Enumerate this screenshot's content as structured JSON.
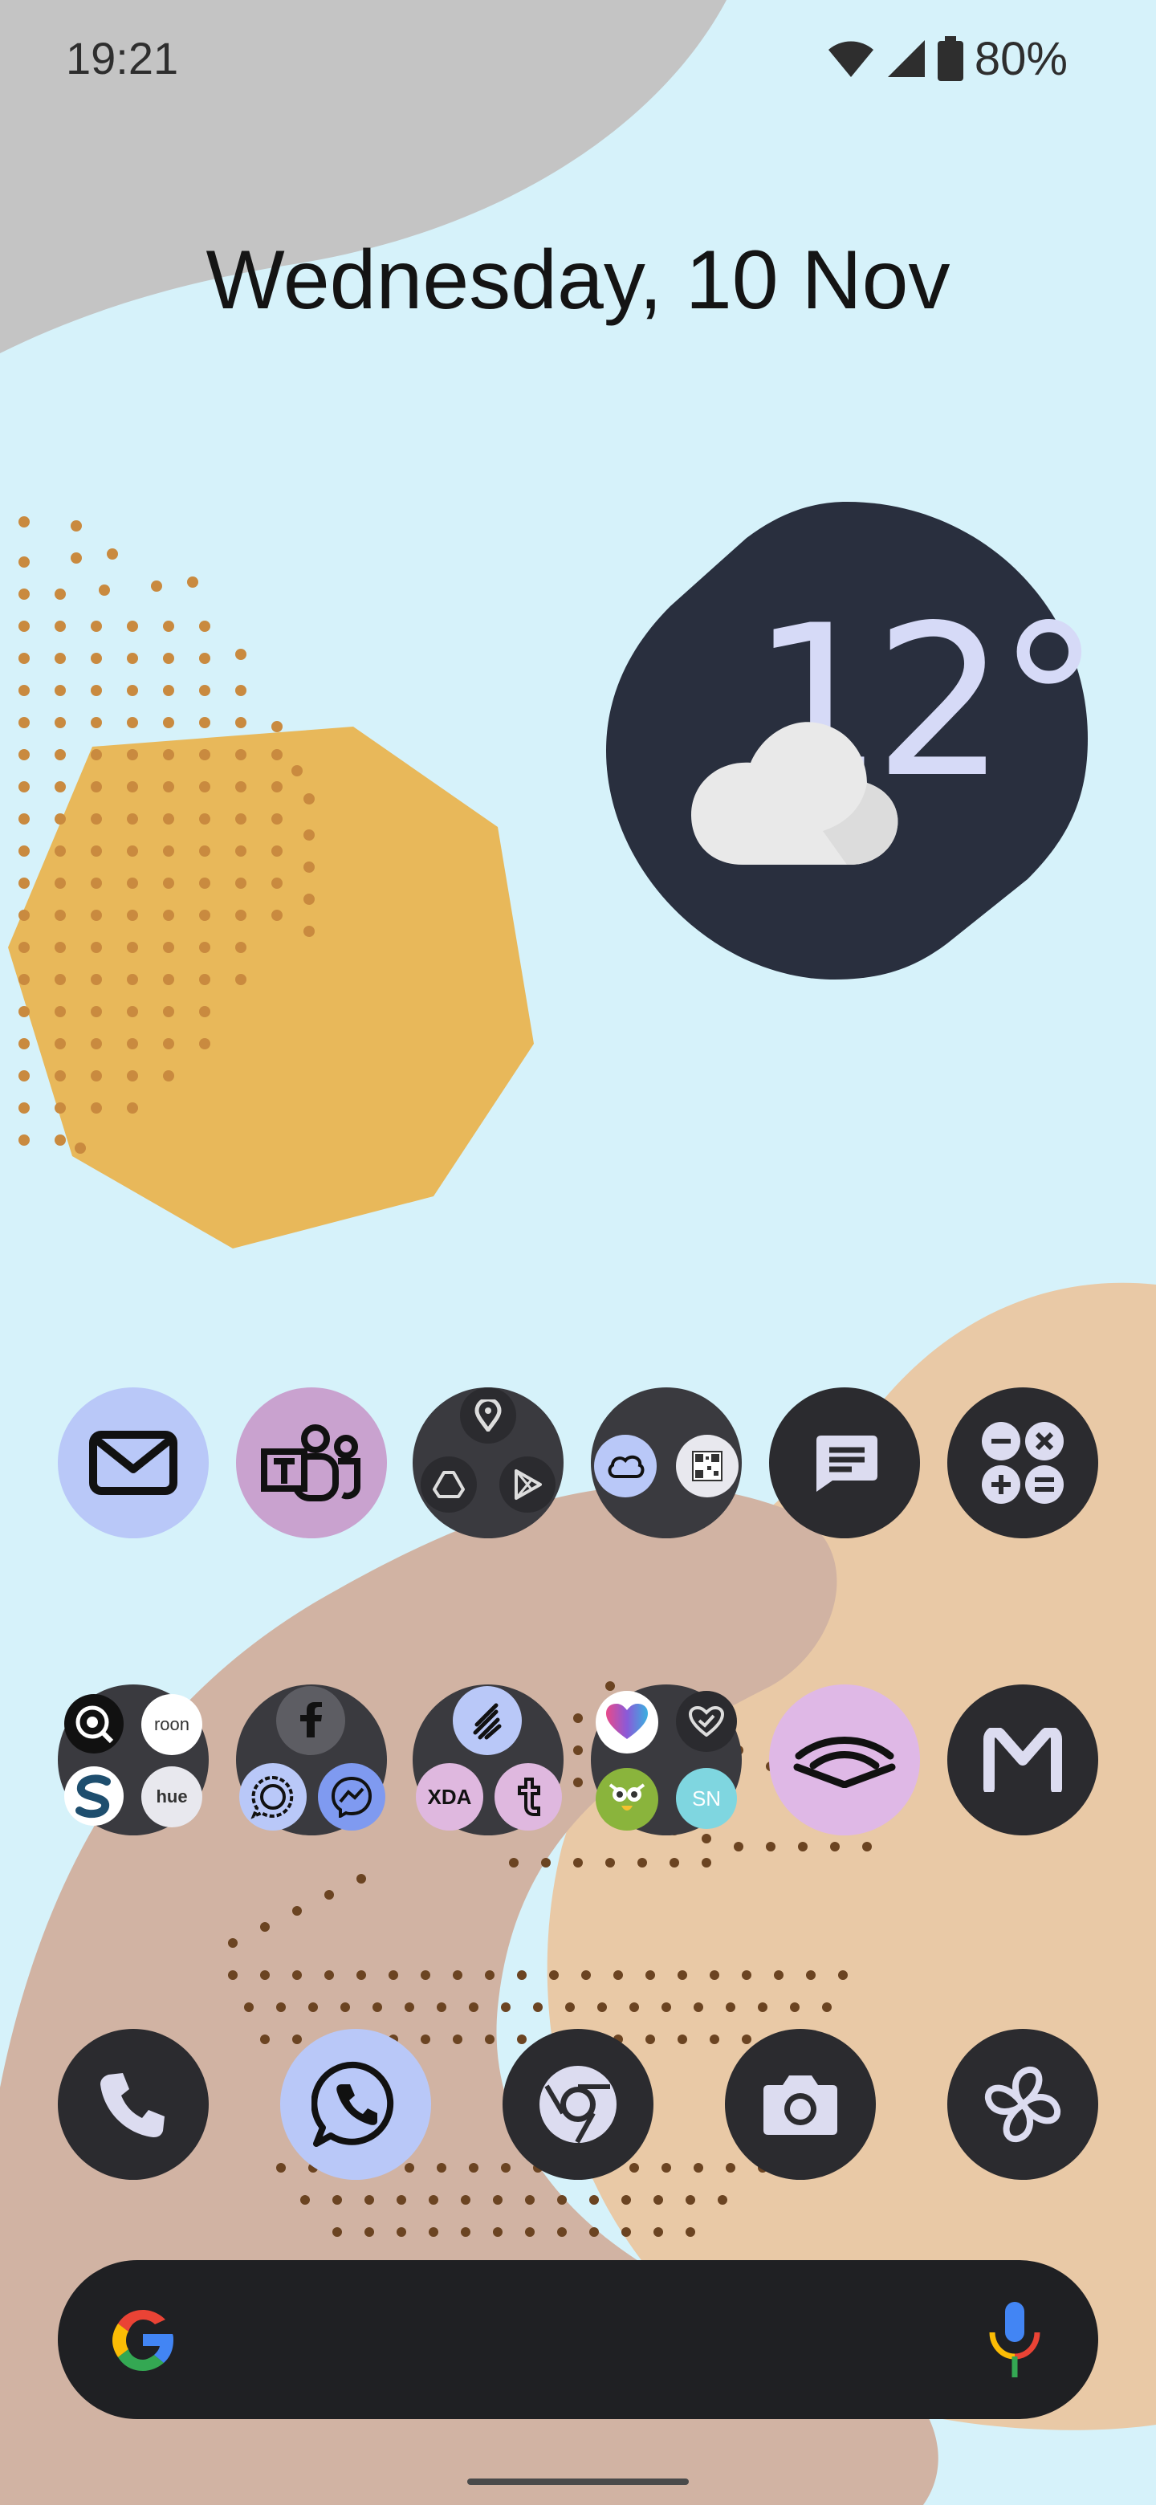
{
  "status_bar": {
    "time": "19:21",
    "battery_percent": "80%"
  },
  "date_widget": {
    "text": "Wednesday, 10 Nov"
  },
  "weather_widget": {
    "temperature": "12°",
    "condition_icon": "cloud-icon"
  },
  "folders": {
    "hue_label": "hue",
    "roon_label": "roon",
    "xda_label": "XDA",
    "sn_label": "SN"
  },
  "colors": {
    "background": "#d6f2fa",
    "icon_dark": "#2b2b2f",
    "icon_lavender": "#b9c8f8",
    "icon_mauve": "#c9a2cf",
    "icon_pink": "#dfb8df",
    "search_bar": "#1f2023"
  }
}
